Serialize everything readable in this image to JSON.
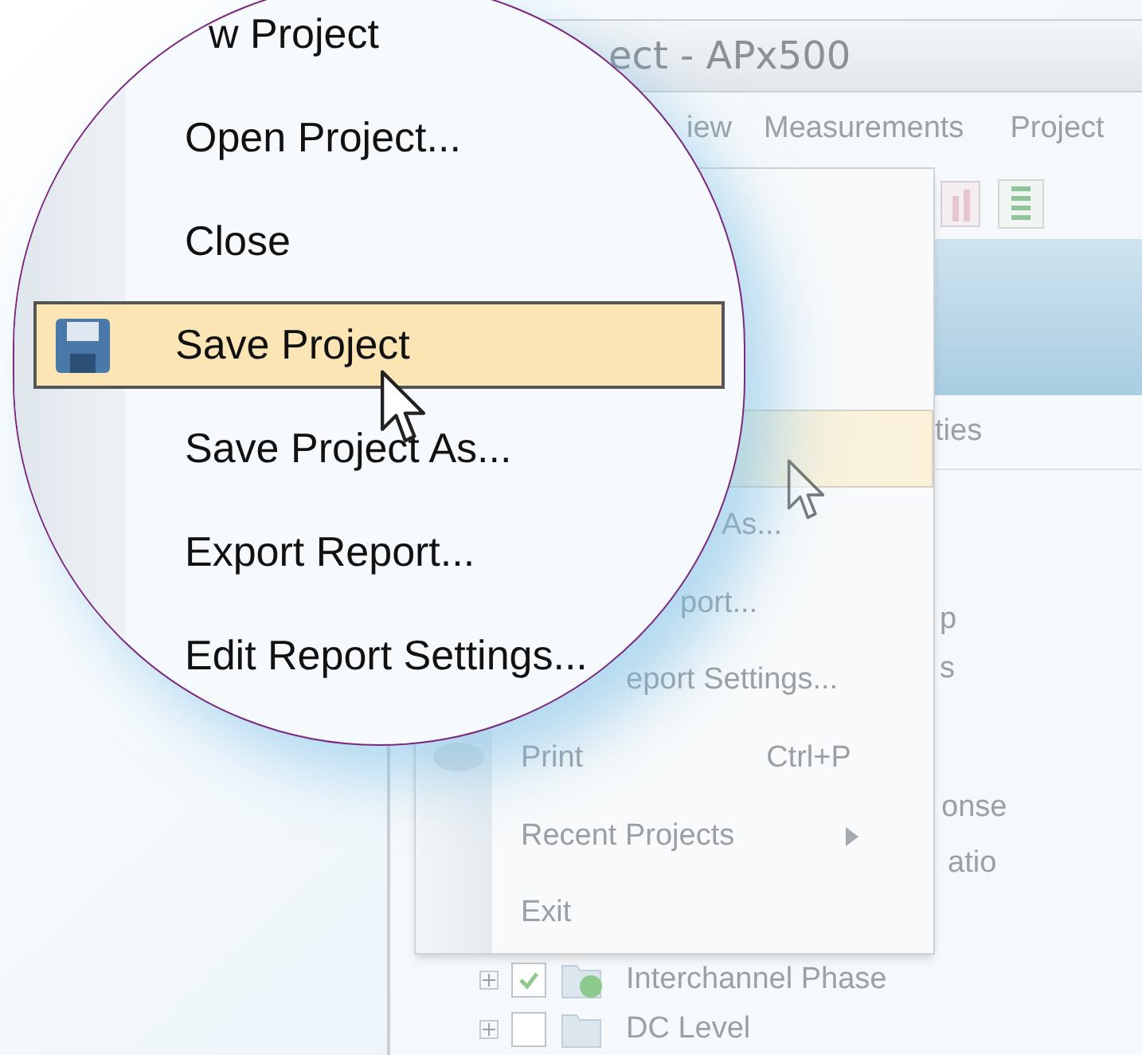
{
  "window": {
    "title": "ect - APx500"
  },
  "menubar": [
    {
      "label": "iew"
    },
    {
      "label": "Measurements"
    },
    {
      "label": "Project"
    }
  ],
  "tabs": {
    "label": "ties"
  },
  "tree": [
    {
      "kind": "fragment",
      "label": "p"
    },
    {
      "kind": "fragment",
      "label": "s"
    },
    {
      "kind": "fragment",
      "label": "onse"
    },
    {
      "kind": "fragment",
      "label": "atio"
    },
    {
      "kind": "node",
      "label": "Interchannel Phase",
      "checked": true
    },
    {
      "kind": "node",
      "label": "DC Level",
      "checked": false
    }
  ],
  "file_menu": [
    {
      "selected": true
    },
    {
      "label": "As...",
      "selected": false
    },
    {
      "label": "port...",
      "selected": false
    },
    {
      "label": "eport Settings...",
      "selected": false
    },
    {
      "label": "Print",
      "shortcut": "Ctrl+P",
      "selected": false
    },
    {
      "label": "Recent Projects",
      "submenu": true,
      "selected": false
    },
    {
      "label": "Exit",
      "selected": false
    }
  ],
  "magnifier": {
    "items": [
      {
        "label": "w Project",
        "selected": false
      },
      {
        "label": "Open Project...",
        "selected": false
      },
      {
        "label": "Close",
        "selected": false
      },
      {
        "label": "Save Project",
        "selected": true
      },
      {
        "label": "Save Project As...",
        "selected": false
      },
      {
        "label": "Export Report...",
        "selected": false
      },
      {
        "label": "Edit Report Settings...",
        "selected": false
      }
    ]
  }
}
